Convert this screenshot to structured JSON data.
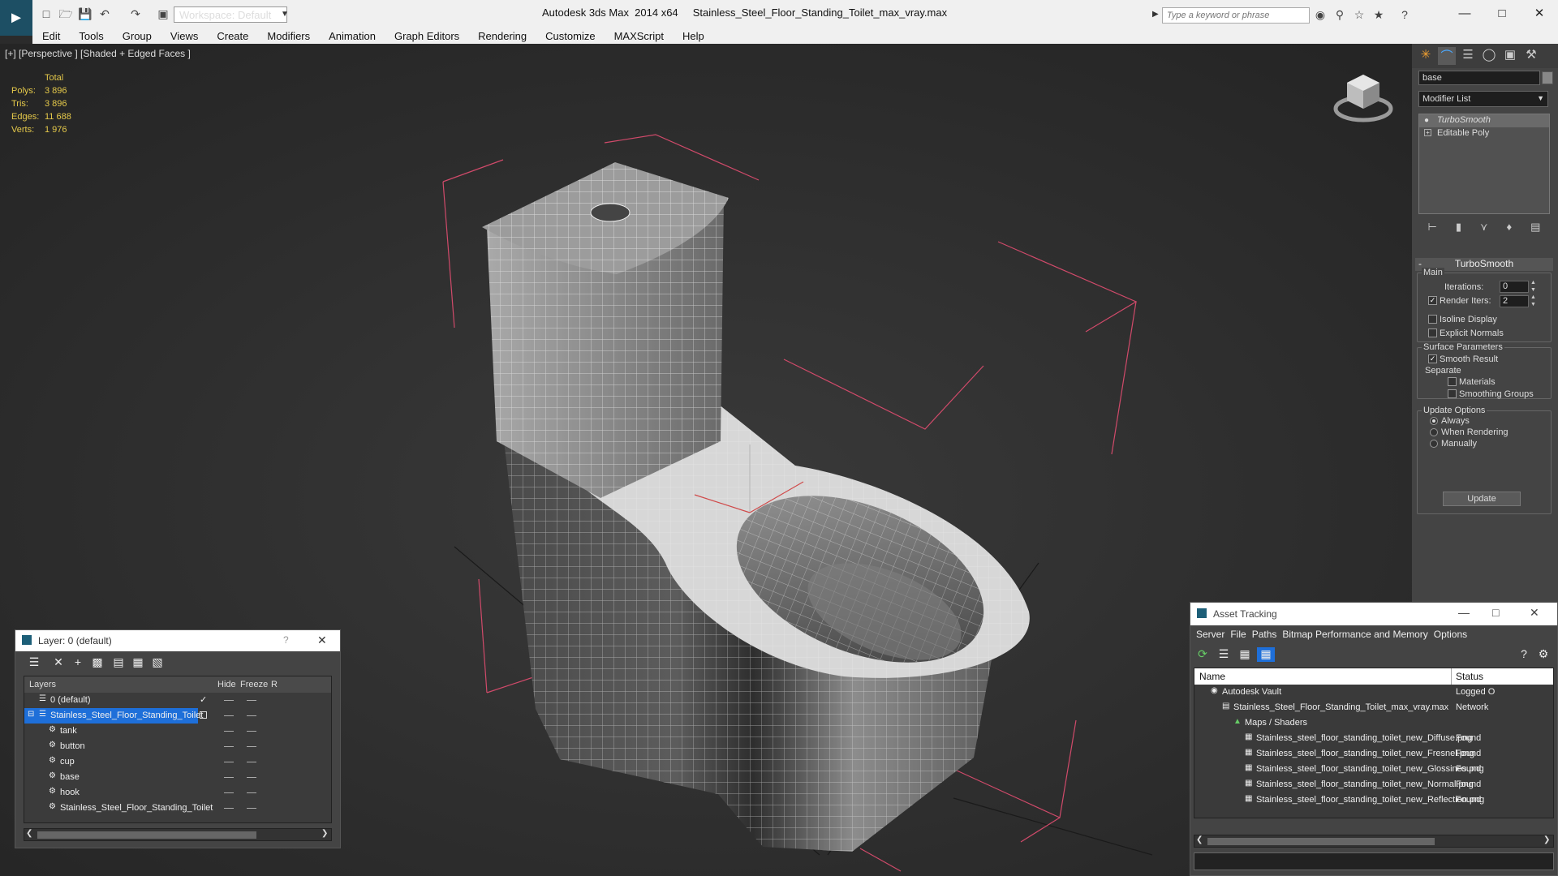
{
  "window": {
    "workspace": "Workspace: Default",
    "app_name": "Autodesk 3ds Max  2014 x64",
    "file_name": "Stainless_Steel_Floor_Standing_Toilet_max_vray.max",
    "search_placeholder": "Type a keyword or phrase"
  },
  "menu": [
    "Edit",
    "Tools",
    "Group",
    "Views",
    "Create",
    "Modifiers",
    "Animation",
    "Graph Editors",
    "Rendering",
    "Customize",
    "MAXScript",
    "Help"
  ],
  "viewport": {
    "label": "[+] [Perspective ] [Shaded + Edged Faces ]",
    "stats": {
      "header": "Total",
      "polys_label": "Polys:",
      "polys": "3 896",
      "tris_label": "Tris:",
      "tris": "3 896",
      "edges_label": "Edges:",
      "edges": "11 688",
      "verts_label": "Verts:",
      "verts": "1 976"
    }
  },
  "command_panel": {
    "object_name": "base",
    "modifier_list": "Modifier List",
    "stack": [
      "TurboSmooth",
      "Editable Poly"
    ],
    "rollout_title": "TurboSmooth",
    "main_label": "Main",
    "iterations_label": "Iterations:",
    "iterations": "0",
    "render_iters_label": "Render Iters:",
    "render_iters": "2",
    "isoline_label": "Isoline Display",
    "explicit_normals_label": "Explicit Normals",
    "surface_params_label": "Surface Parameters",
    "smooth_result_label": "Smooth Result",
    "separate_label": "Separate",
    "materials_label": "Materials",
    "smoothing_groups_label": "Smoothing Groups",
    "update_options_label": "Update Options",
    "always_label": "Always",
    "when_rendering_label": "When Rendering",
    "manually_label": "Manually",
    "update_button": "Update"
  },
  "layer_dialog": {
    "title": "Layer: 0 (default)",
    "help": "?",
    "columns": {
      "layers": "Layers",
      "hide": "Hide",
      "freeze": "Freeze",
      "render": "R"
    },
    "rows": [
      {
        "name": "0 (default)"
      },
      {
        "name": "Stainless_Steel_Floor_Standing_Toilet"
      },
      {
        "name": "tank"
      },
      {
        "name": "button"
      },
      {
        "name": "cup"
      },
      {
        "name": "base"
      },
      {
        "name": "hook"
      },
      {
        "name": "Stainless_Steel_Floor_Standing_Toilet"
      }
    ]
  },
  "asset_tracking": {
    "title": "Asset Tracking",
    "menu": [
      "Server",
      "File",
      "Paths",
      "Bitmap Performance and Memory",
      "Options"
    ],
    "columns": {
      "name": "Name",
      "status": "Status"
    },
    "rows": [
      {
        "name": "Autodesk Vault",
        "status": "Logged O"
      },
      {
        "name": "Stainless_Steel_Floor_Standing_Toilet_max_vray.max",
        "status": "Network"
      },
      {
        "name": "Maps / Shaders",
        "status": ""
      },
      {
        "name": "Stainless_steel_floor_standing_toilet_new_Diffuse.png",
        "status": "Found"
      },
      {
        "name": "Stainless_steel_floor_standing_toilet_new_Fresnel.png",
        "status": "Found"
      },
      {
        "name": "Stainless_steel_floor_standing_toilet_new_Glossines.png",
        "status": "Found"
      },
      {
        "name": "Stainless_steel_floor_standing_toilet_new_Normal.png",
        "status": "Found"
      },
      {
        "name": "Stainless_steel_floor_standing_toilet_new_Reflection.png",
        "status": "Found"
      }
    ]
  },
  "colors": {
    "accent": "#1d5fa8",
    "stats": "#e5c94a",
    "bbox": "#d04a6a",
    "selection": "#1e6fd9"
  }
}
